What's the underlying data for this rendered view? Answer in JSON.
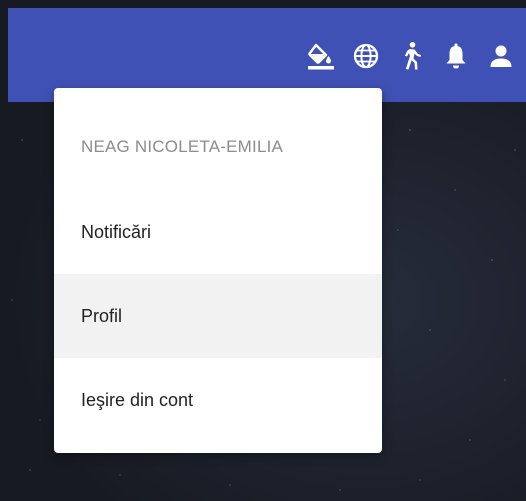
{
  "toolbar": {
    "icons": [
      "paint-bucket-icon",
      "globe-icon",
      "accessibility-icon",
      "bell-icon",
      "account-icon"
    ],
    "bar_color": "#3f51b5"
  },
  "menu": {
    "user_name": "NEAG NICOLETA-EMILIA",
    "items": [
      {
        "label": "Notificări"
      },
      {
        "label": "Profil",
        "state": "hovered"
      },
      {
        "label": "Ieşire din cont"
      }
    ]
  }
}
